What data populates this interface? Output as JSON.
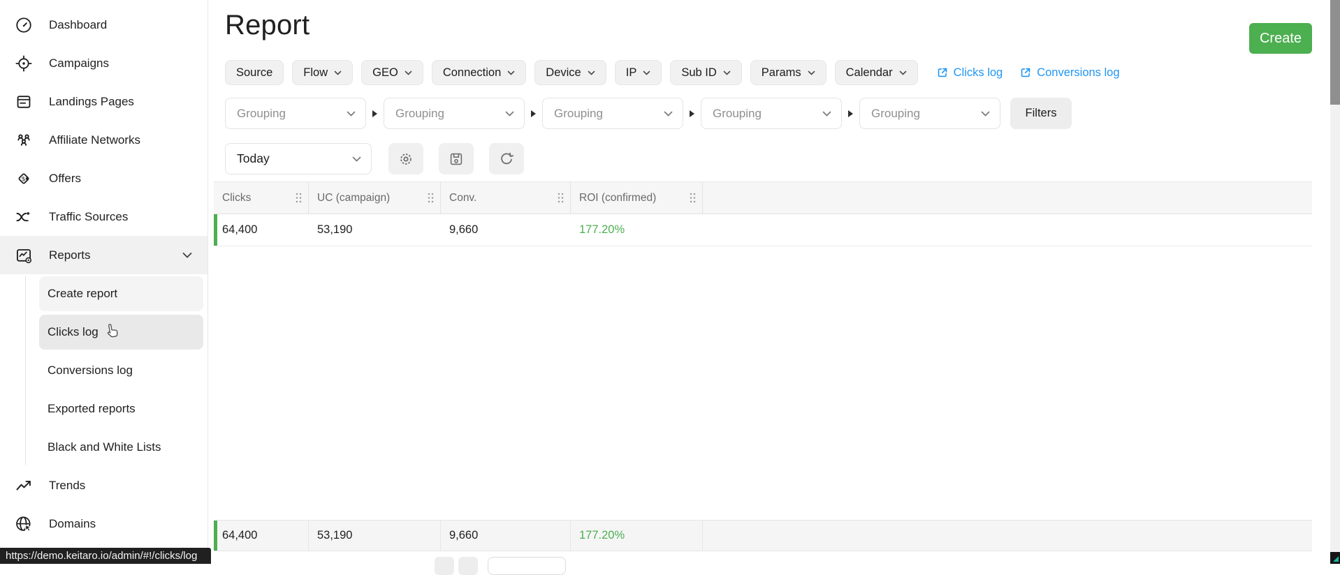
{
  "app": {
    "page_title": "Report",
    "create_label": "Create",
    "url_tooltip": "https://demo.keitaro.io/admin/#!/clicks/log"
  },
  "sidebar": {
    "items": [
      {
        "label": "Dashboard"
      },
      {
        "label": "Campaigns"
      },
      {
        "label": "Landings Pages"
      },
      {
        "label": "Affiliate Networks"
      },
      {
        "label": "Offers"
      },
      {
        "label": "Traffic Sources"
      },
      {
        "label": "Reports",
        "expanded": true
      },
      {
        "label": "Trends"
      },
      {
        "label": "Domains"
      }
    ],
    "report_subitems": [
      {
        "label": "Create report",
        "state": "selected"
      },
      {
        "label": "Clicks log",
        "state": "hovered"
      },
      {
        "label": "Conversions log",
        "state": "normal"
      },
      {
        "label": "Exported reports",
        "state": "normal"
      },
      {
        "label": "Black and White Lists",
        "state": "normal"
      }
    ]
  },
  "filters": {
    "chips": [
      {
        "label": "Source",
        "chevron": false
      },
      {
        "label": "Flow",
        "chevron": true
      },
      {
        "label": "GEO",
        "chevron": true
      },
      {
        "label": "Connection",
        "chevron": true
      },
      {
        "label": "Device",
        "chevron": true
      },
      {
        "label": "IP",
        "chevron": true
      },
      {
        "label": "Sub ID",
        "chevron": true
      },
      {
        "label": "Params",
        "chevron": true
      },
      {
        "label": "Calendar",
        "chevron": true
      }
    ],
    "links": [
      {
        "label": "Clicks log"
      },
      {
        "label": "Conversions log"
      }
    ],
    "grouping_placeholder": "Grouping",
    "grouping_count": 5,
    "filters_button_label": "Filters",
    "date_range_value": "Today"
  },
  "table": {
    "columns": [
      "Clicks",
      "UC (campaign)",
      "Conv.",
      "ROI (confirmed)"
    ],
    "row": {
      "clicks": "64,400",
      "uc": "53,190",
      "conv": "9,660",
      "roi": "177.20%"
    },
    "footer": {
      "clicks": "64,400",
      "uc": "53,190",
      "conv": "9,660",
      "roi": "177.20%"
    }
  },
  "colors": {
    "accent_green": "#4caf50",
    "link_blue": "#2196f3",
    "roi_green": "#4caf50"
  }
}
